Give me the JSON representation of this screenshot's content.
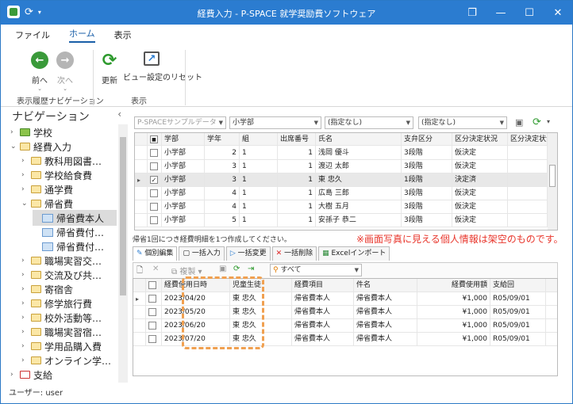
{
  "window": {
    "title": "経費入力 - P-SPACE 就学奨励費ソフトウェア",
    "controls": [
      "❐",
      "—",
      "☐",
      "✕"
    ]
  },
  "ribbon_tabs": [
    {
      "label": "ファイル"
    },
    {
      "label": "ホーム"
    },
    {
      "label": "表示"
    }
  ],
  "ribbon": {
    "back_label": "前へ",
    "forward_label": "次へ",
    "refresh_label": "更新",
    "view_reset_label": "ビュー設定のリセット",
    "group_history": "表示履歴ナビゲーション",
    "group_view": "表示"
  },
  "nav": {
    "header": "ナビゲーション",
    "collapse_glyph": "‹",
    "items": [
      {
        "label": "学校",
        "level": 0,
        "icon": "school-icon",
        "arrow": "›"
      },
      {
        "label": "経費入力",
        "level": 0,
        "icon": "folder-icon",
        "arrow": "⌄"
      },
      {
        "label": "教科用図書…",
        "level": 1,
        "icon": "folder-icon",
        "arrow": "›"
      },
      {
        "label": "学校給食費",
        "level": 1,
        "icon": "folder-icon",
        "arrow": "›"
      },
      {
        "label": "通学費",
        "level": 1,
        "icon": "folder-icon",
        "arrow": "›"
      },
      {
        "label": "帰省費",
        "level": 1,
        "icon": "folder-icon",
        "arrow": "⌄"
      },
      {
        "label": "帰省費本人",
        "level": 2,
        "icon": "document-icon",
        "arrow": ""
      },
      {
        "label": "帰省費付…",
        "level": 2,
        "icon": "document-icon",
        "arrow": ""
      },
      {
        "label": "帰省費付…",
        "level": 2,
        "icon": "document-icon",
        "arrow": ""
      },
      {
        "label": "職場実習交…",
        "level": 1,
        "icon": "folder-icon",
        "arrow": "›"
      },
      {
        "label": "交流及び共…",
        "level": 1,
        "icon": "folder-icon",
        "arrow": "›"
      },
      {
        "label": "寄宿舎",
        "level": 1,
        "icon": "folder-icon",
        "arrow": "›"
      },
      {
        "label": "修学旅行費",
        "level": 1,
        "icon": "folder-icon",
        "arrow": "›"
      },
      {
        "label": "校外活動等…",
        "level": 1,
        "icon": "folder-icon",
        "arrow": "›"
      },
      {
        "label": "職場実習宿…",
        "level": 1,
        "icon": "folder-icon",
        "arrow": "›"
      },
      {
        "label": "学用品購入費",
        "level": 1,
        "icon": "folder-icon",
        "arrow": "›"
      },
      {
        "label": "オンライン学…",
        "level": 1,
        "icon": "folder-icon",
        "arrow": "›"
      },
      {
        "label": "支給",
        "level": 0,
        "icon": "calendar-icon",
        "arrow": "›"
      }
    ]
  },
  "filters": {
    "school": "P-SPACEサンプルデータ",
    "division": "小学部",
    "filter1": "(指定なし)",
    "filter2": "(指定なし)"
  },
  "grid1": {
    "headers": [
      "",
      "学部",
      "学年",
      "組",
      "出席番号",
      "氏名",
      "支弁区分",
      "区分決定状況"
    ],
    "rows": [
      {
        "checked": false,
        "dept": "小学部",
        "grade": "2",
        "cls": "1",
        "num": "1",
        "name": "浅岡 優斗",
        "level": "3段階",
        "status": "仮決定",
        "current": false
      },
      {
        "checked": false,
        "dept": "小学部",
        "grade": "3",
        "cls": "1",
        "num": "1",
        "name": "渡辺 太郎",
        "level": "3段階",
        "status": "仮決定",
        "current": false
      },
      {
        "checked": true,
        "dept": "小学部",
        "grade": "3",
        "cls": "1",
        "num": "1",
        "name": "東 忠久",
        "level": "1段階",
        "status": "決定済",
        "current": true
      },
      {
        "checked": false,
        "dept": "小学部",
        "grade": "4",
        "cls": "1",
        "num": "1",
        "name": "広島 三郎",
        "level": "3段階",
        "status": "仮決定",
        "current": false
      },
      {
        "checked": false,
        "dept": "小学部",
        "grade": "4",
        "cls": "1",
        "num": "1",
        "name": "大樹 五月",
        "level": "3段階",
        "status": "仮決定",
        "current": false
      },
      {
        "checked": false,
        "dept": "小学部",
        "grade": "5",
        "cls": "1",
        "num": "1",
        "name": "安孫子 恭二",
        "level": "3段階",
        "status": "仮決定",
        "current": false
      }
    ]
  },
  "note": "帰省1回につき経費明細を1つ作成してください。",
  "warning": "※画面写真に見える個人情報は架空のものです。",
  "tabs2": [
    {
      "label": "個別編集"
    },
    {
      "label": "一括入力"
    },
    {
      "label": "一括変更"
    },
    {
      "label": "一括削除"
    },
    {
      "label": "Excelインポート"
    }
  ],
  "toolbar2": {
    "copy_label": "複製",
    "filter_label": "すべて"
  },
  "grid2": {
    "headers": [
      "",
      "経費使用日時",
      "児童生徒",
      "経費項目",
      "件名",
      "経費使用額",
      "支給回"
    ],
    "rows": [
      {
        "date": "2023/04/20",
        "student": "東 忠久",
        "item": "帰省費本人",
        "subject": "帰省費本人",
        "amount": "¥1,000",
        "round": "R05/09/01"
      },
      {
        "date": "2023/05/20",
        "student": "東 忠久",
        "item": "帰省費本人",
        "subject": "帰省費本人",
        "amount": "¥1,000",
        "round": "R05/09/01"
      },
      {
        "date": "2023/06/20",
        "student": "東 忠久",
        "item": "帰省費本人",
        "subject": "帰省費本人",
        "amount": "¥1,000",
        "round": "R05/09/01"
      },
      {
        "date": "2023/07/20",
        "student": "東 忠久",
        "item": "帰省費本人",
        "subject": "帰省費本人",
        "amount": "¥1,000",
        "round": "R05/09/01"
      }
    ]
  },
  "status": "ユーザー: user",
  "colors": {
    "titlebar": "#2b7cd0",
    "accent": "#1a5fa8",
    "warning": "#e8342a",
    "highlight": "#f0a050"
  }
}
